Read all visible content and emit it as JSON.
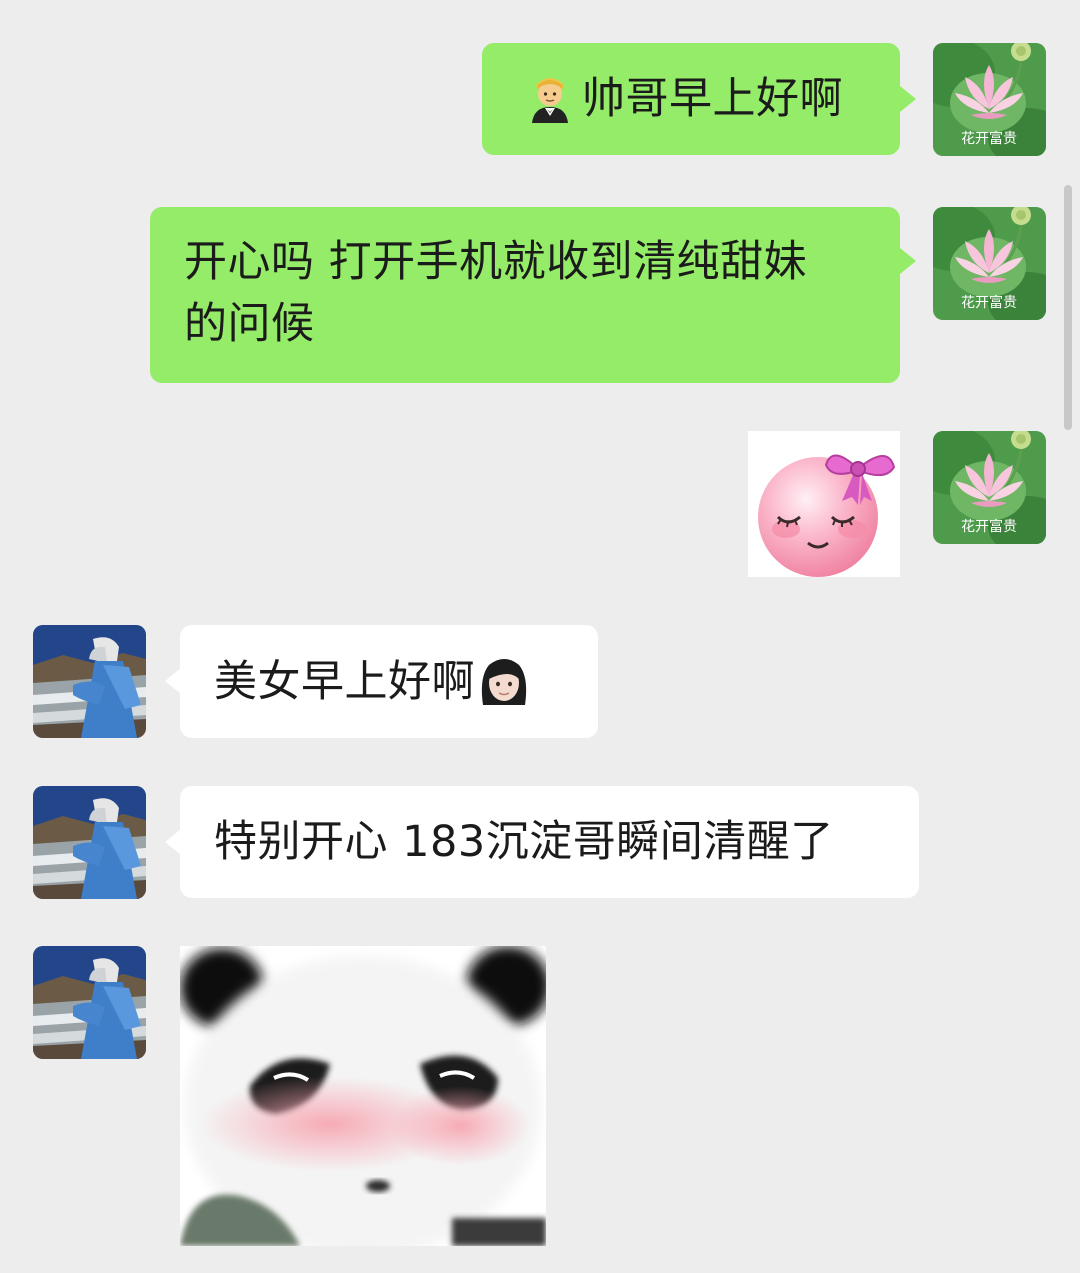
{
  "chat": {
    "contact_avatar_caption": "花开富贵",
    "messages": [
      {
        "side": "right",
        "type": "text",
        "text": "帅哥早上好啊",
        "emoji": "person-in-tuxedo"
      },
      {
        "side": "right",
        "type": "text",
        "lines": [
          "开心吗 打开手机就收到清纯甜妹",
          "的问候"
        ]
      },
      {
        "side": "right",
        "type": "sticker",
        "sticker": "pink-smiley-with-bow"
      },
      {
        "side": "left",
        "type": "text",
        "text": "美女早上好啊",
        "emoji": "woman-face"
      },
      {
        "side": "left",
        "type": "text",
        "text": "特别开心 183沉淀哥瞬间清醒了"
      },
      {
        "side": "left",
        "type": "sticker",
        "sticker": "blushing-panda-meme"
      }
    ]
  },
  "colors": {
    "background": "#ededed",
    "bubble_self": "#95ec69",
    "bubble_other": "#ffffff"
  }
}
